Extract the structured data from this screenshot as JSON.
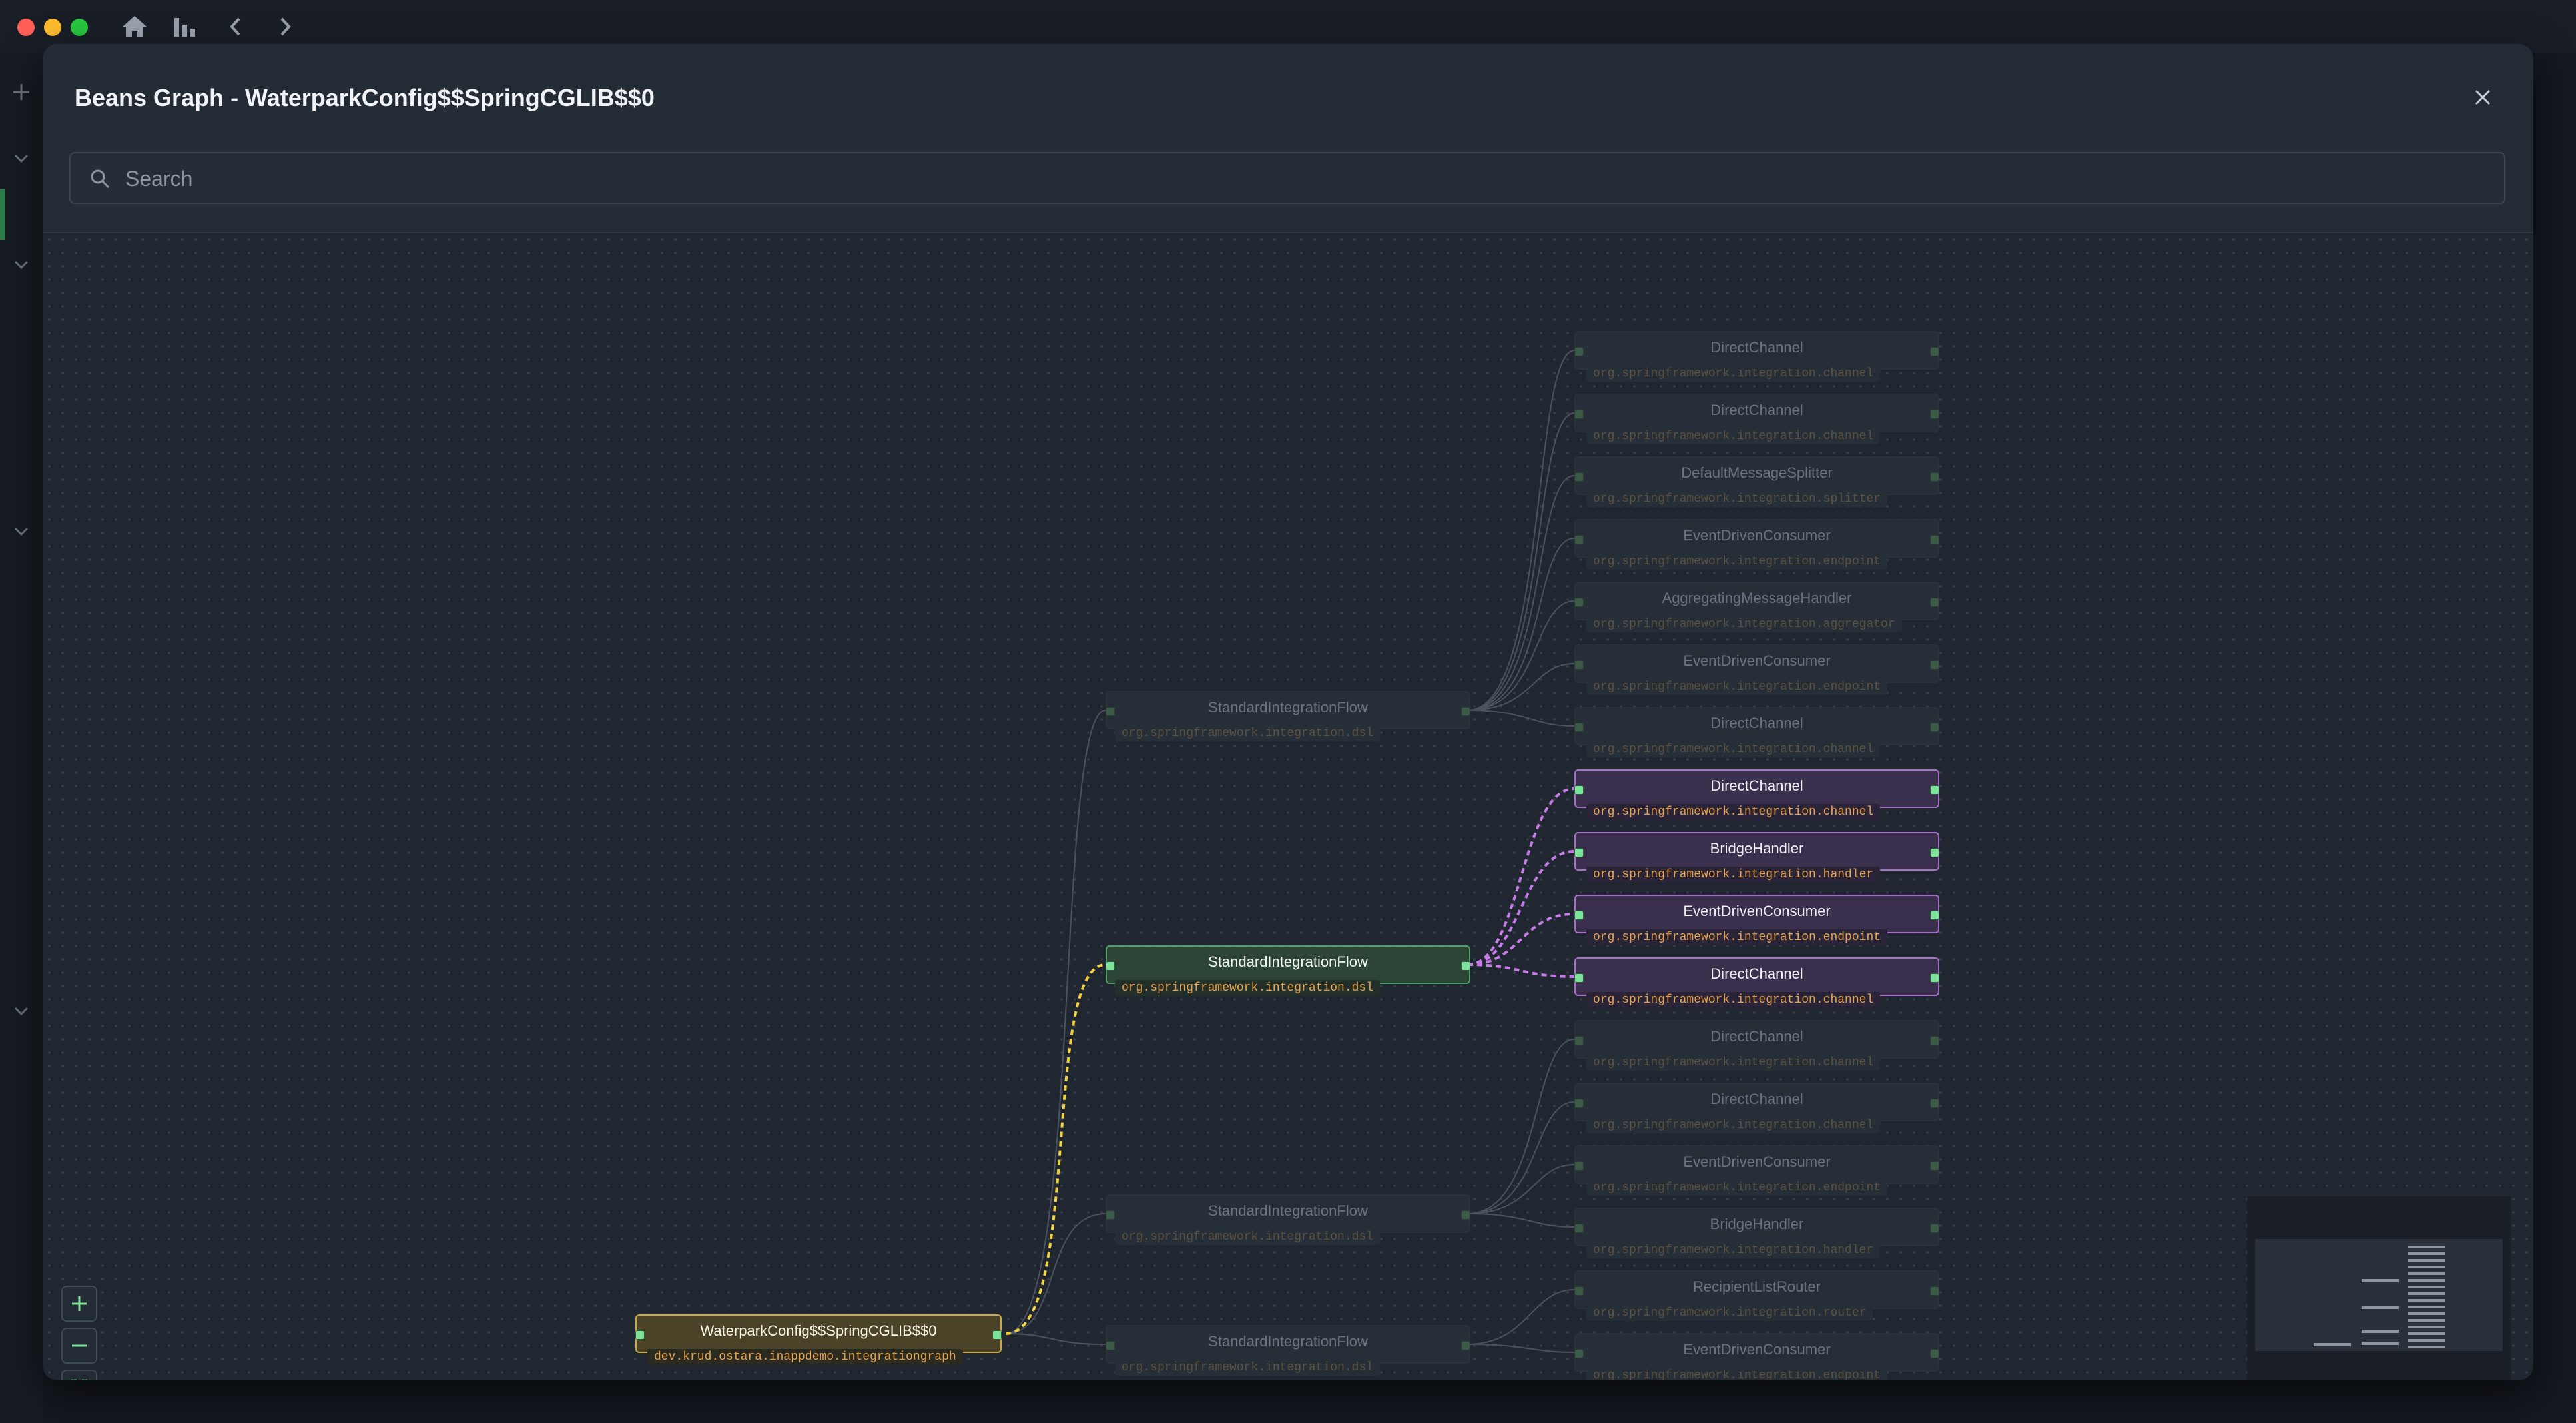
{
  "window": {
    "traffic_lights": {
      "close": "#ff5f57",
      "minimize": "#febc2e",
      "zoom": "#28c840"
    },
    "toolbar": {
      "home_icon": "home-icon",
      "charts_icon": "bar-chart-icon",
      "back_icon": "chevron-left-icon",
      "forward_icon": "chevron-right-icon"
    }
  },
  "modal": {
    "title": "Beans Graph - WaterparkConfig$$SpringCGLIB$$0",
    "close_icon": "close-icon",
    "search": {
      "placeholder": "Search",
      "value": ""
    }
  },
  "colors": {
    "highlight_root": "#c9aa45",
    "highlight_flow": "#4fa06a",
    "highlight_children": "#a870c9",
    "package_text": "#e9a34a",
    "port": "#7ee29b"
  },
  "graph": {
    "root": {
      "name": "WaterparkConfig$$SpringCGLIB$$0",
      "package": "dev.krud.ostara.inappdemo.integrationgraph",
      "state": "highlight-root"
    },
    "flows": [
      {
        "name": "StandardIntegrationFlow",
        "package": "org.springframework.integration.dsl",
        "state": "dim"
      },
      {
        "name": "StandardIntegrationFlow",
        "package": "org.springframework.integration.dsl",
        "state": "highlight-flow"
      },
      {
        "name": "StandardIntegrationFlow",
        "package": "org.springframework.integration.dsl",
        "state": "dim"
      },
      {
        "name": "StandardIntegrationFlow",
        "package": "org.springframework.integration.dsl",
        "state": "dim"
      }
    ],
    "beans": [
      {
        "name": "DirectChannel",
        "package": "org.springframework.integration.channel",
        "state": "dim"
      },
      {
        "name": "DirectChannel",
        "package": "org.springframework.integration.channel",
        "state": "dim"
      },
      {
        "name": "DefaultMessageSplitter",
        "package": "org.springframework.integration.splitter",
        "state": "dim"
      },
      {
        "name": "EventDrivenConsumer",
        "package": "org.springframework.integration.endpoint",
        "state": "dim"
      },
      {
        "name": "AggregatingMessageHandler",
        "package": "org.springframework.integration.aggregator",
        "state": "dim"
      },
      {
        "name": "EventDrivenConsumer",
        "package": "org.springframework.integration.endpoint",
        "state": "dim"
      },
      {
        "name": "DirectChannel",
        "package": "org.springframework.integration.channel",
        "state": "dim"
      },
      {
        "name": "DirectChannel",
        "package": "org.springframework.integration.channel",
        "state": "highlight-child"
      },
      {
        "name": "BridgeHandler",
        "package": "org.springframework.integration.handler",
        "state": "highlight-child"
      },
      {
        "name": "EventDrivenConsumer",
        "package": "org.springframework.integration.endpoint",
        "state": "highlight-child"
      },
      {
        "name": "DirectChannel",
        "package": "org.springframework.integration.channel",
        "state": "highlight-child"
      },
      {
        "name": "DirectChannel",
        "package": "org.springframework.integration.channel",
        "state": "dim"
      },
      {
        "name": "DirectChannel",
        "package": "org.springframework.integration.channel",
        "state": "dim"
      },
      {
        "name": "EventDrivenConsumer",
        "package": "org.springframework.integration.endpoint",
        "state": "dim"
      },
      {
        "name": "BridgeHandler",
        "package": "org.springframework.integration.handler",
        "state": "dim"
      },
      {
        "name": "RecipientListRouter",
        "package": "org.springframework.integration.router",
        "state": "dim"
      },
      {
        "name": "EventDrivenConsumer",
        "package": "org.springframework.integration.endpoint",
        "state": "dim"
      }
    ]
  },
  "controls": {
    "zoom_in_icon": "plus-icon",
    "zoom_out_icon": "minus-icon",
    "fit_view_icon": "fit-view-icon"
  }
}
